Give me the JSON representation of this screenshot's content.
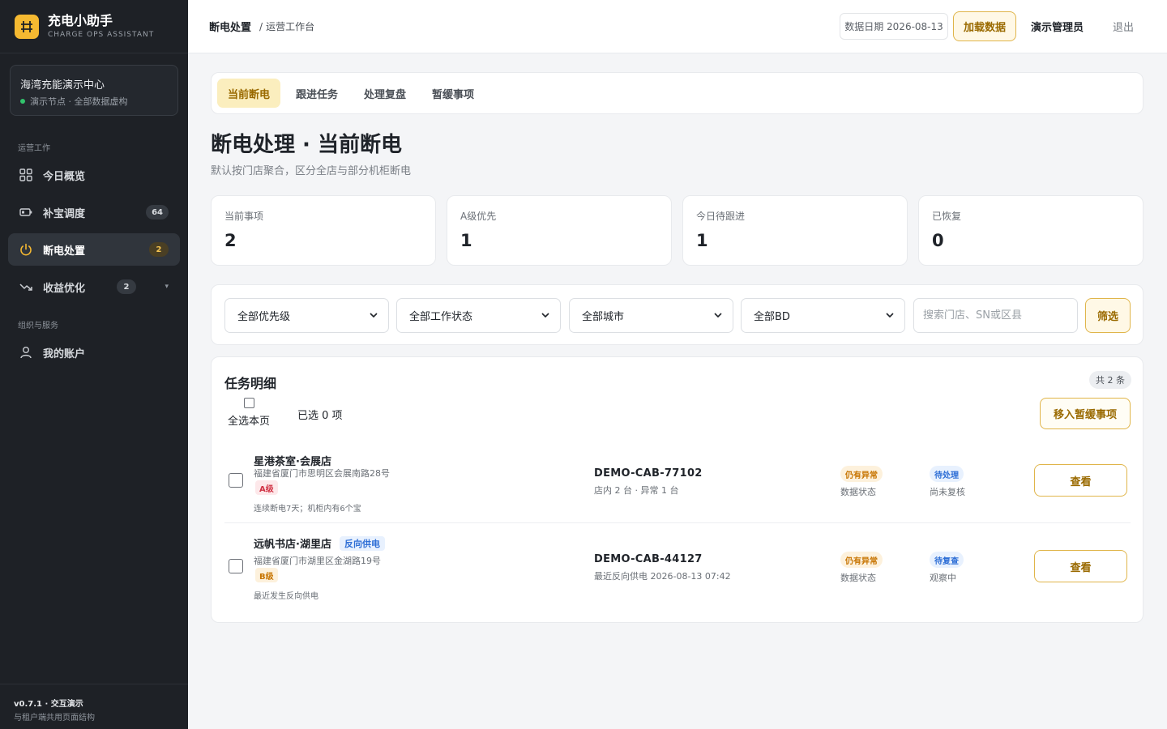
{
  "brand": {
    "title": "充电小助手",
    "subtitle": "CHARGE OPS ASSISTANT",
    "accent": "#f5b931"
  },
  "org": {
    "name": "海湾充能演示中心",
    "note": "演示节点 · 全部数据虚构"
  },
  "nav": {
    "group_ops": "运营工作",
    "group_org": "组织与服务",
    "items": [
      {
        "label": "今日概览",
        "icon": "grid-icon"
      },
      {
        "label": "补宝调度",
        "icon": "battery-icon",
        "badge": "64"
      },
      {
        "label": "断电处置",
        "icon": "power-icon",
        "badge": "2"
      },
      {
        "label": "收益优化",
        "icon": "trend-down-icon",
        "badge": "2"
      },
      {
        "label": "我的账户",
        "icon": "user-icon"
      }
    ]
  },
  "footer": {
    "version": "v0.7.1 · 交互演示",
    "note": "与租户端共用页面结构"
  },
  "topbar": {
    "crumb_main": "断电处置",
    "crumb_sep": "/",
    "crumb_sub": "运营工作台",
    "date": "数据日期 2026-08-13",
    "load_label": "加载数据",
    "user": "演示管理员",
    "logout": "退出"
  },
  "tabs": [
    "当前断电",
    "跟进任务",
    "处理复盘",
    "暂缓事项"
  ],
  "page": {
    "title": "断电处理 · 当前断电",
    "desc": "默认按门店聚合，区分全店与部分机柜断电"
  },
  "stats": [
    {
      "label": "当前事项",
      "value": "2"
    },
    {
      "label": "A级优先",
      "value": "1"
    },
    {
      "label": "今日待跟进",
      "value": "1"
    },
    {
      "label": "已恢复",
      "value": "0"
    }
  ],
  "filters": {
    "priority": "全部优先级",
    "status": "全部工作状态",
    "city": "全部城市",
    "bd": "全部BD",
    "search_placeholder": "搜索门店、SN或区县",
    "filter_label": "筛选"
  },
  "tasks": {
    "title": "任务明细",
    "count": "共 2 条",
    "select_all": "全选本页",
    "selected": "已选 0 项",
    "defer_label": "移入暂缓事项",
    "rows": [
      {
        "store": "星港茶室·会展店",
        "tag": "",
        "address": "福建省厦门市思明区会展南路28号",
        "grade": "A级",
        "note": "连续断电7天；机柜内有6个宝",
        "cabinet": "DEMO-CAB-77102",
        "cabinet_note": "店内 2 台 · 异常 1 台",
        "data_status": "仍有异常",
        "data_status_label": "数据状态",
        "work_status": "待处理",
        "work_status_label": "尚未复核",
        "view_label": "查看"
      },
      {
        "store": "远帆书店·湖里店",
        "tag": "反向供电",
        "address": "福建省厦门市湖里区金湖路19号",
        "grade": "B级",
        "note": "最近发生反向供电",
        "cabinet": "DEMO-CAB-44127",
        "cabinet_note": "最近反向供电 2026-08-13 07:42",
        "data_status": "仍有异常",
        "data_status_label": "数据状态",
        "work_status": "待复查",
        "work_status_label": "观察中",
        "view_label": "查看"
      }
    ]
  }
}
